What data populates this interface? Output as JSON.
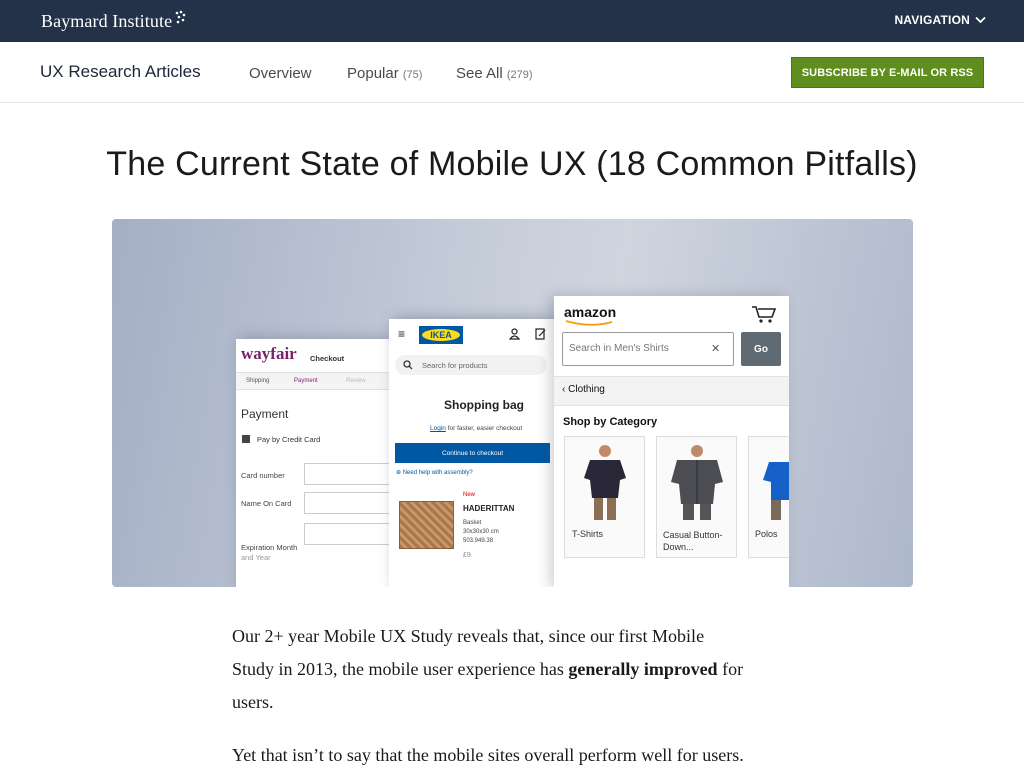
{
  "topbar": {
    "brand": "Baymard Institute",
    "navigation_label": "NAVIGATION"
  },
  "subnav": {
    "title": "UX Research Articles",
    "links": [
      {
        "label": "Overview",
        "count": ""
      },
      {
        "label": "Popular",
        "count": "(75)"
      },
      {
        "label": "See All",
        "count": "(279)"
      }
    ],
    "subscribe_label": "SUBSCRIBE BY E-MAIL OR RSS"
  },
  "article": {
    "title": "The Current State of Mobile UX (18 Common Pitfalls)",
    "p1_a": "Our 2+ year Mobile UX Study reveals that, since our first Mobile",
    "p1_b": "Study in 2013, the mobile user experience has",
    "p1_bold": "generally improved",
    "p1_c": "for",
    "p1_d": "users.",
    "p2": "Yet that isn’t to say that the mobile sites overall perform well for users."
  },
  "hero": {
    "wayfair": {
      "logo": "wayfair",
      "header": "Checkout",
      "steps": [
        "Shipping",
        "Payment",
        "Review"
      ],
      "heading": "Payment",
      "method": "Pay by Credit Card",
      "fields": [
        "Card number",
        "Name On Card",
        "Expiration Month",
        "and Year"
      ]
    },
    "ikea": {
      "logo": "IKEA",
      "search_placeholder": "Search for products",
      "heading": "Shopping bag",
      "login_link": "Login",
      "login_text": "for faster, easier checkout",
      "cta": "Continue to checkout",
      "help": "Need help with assembly?",
      "badge": "New",
      "product_name": "HADERITTAN",
      "product_type": "Basket",
      "product_size": "30x30x30 cm",
      "product_id": "503.949.38",
      "price": "£9"
    },
    "amazon": {
      "logo": "amazon",
      "search_placeholder": "Search in Men's Shirts",
      "go": "Go",
      "back": "Clothing",
      "section": "Shop by Category",
      "categories": [
        "T-Shirts",
        "Casual Button-\nDown...",
        "Polos"
      ]
    }
  },
  "colors": {
    "topbar": "#233249",
    "subscribe": "#5f8e1e",
    "ikea_blue": "#0058a3",
    "ikea_yellow": "#ffda1a",
    "wayfair_purple": "#7b1f6a",
    "amazon_orange": "#ff9900"
  }
}
